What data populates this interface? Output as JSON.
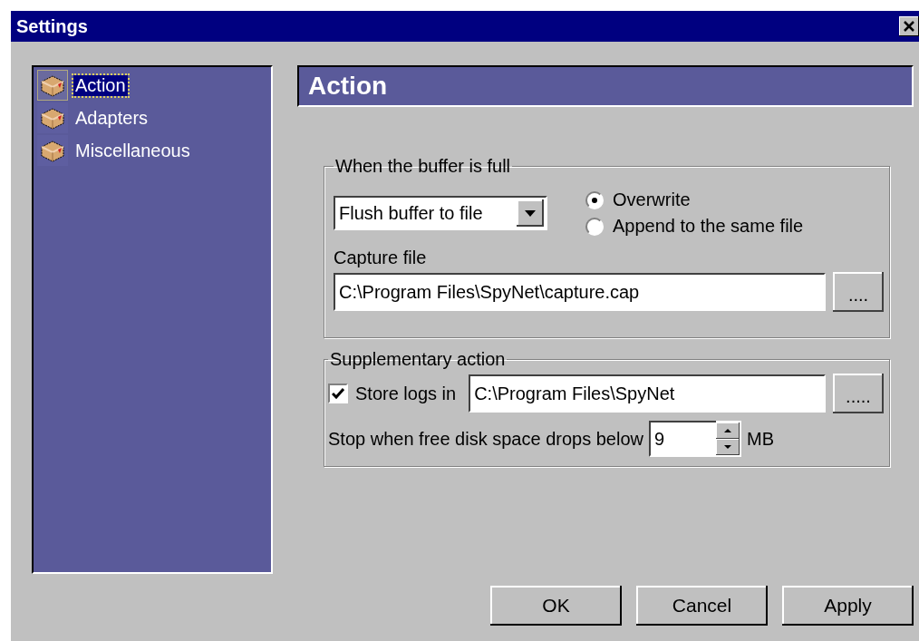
{
  "window": {
    "title": "Settings"
  },
  "sidebar": {
    "items": [
      {
        "label": "Action",
        "selected": true
      },
      {
        "label": "Adapters",
        "selected": false
      },
      {
        "label": "Miscellaneous",
        "selected": false
      }
    ]
  },
  "header": "Action",
  "buffer_group": {
    "title": "When the buffer is full",
    "action": "Flush buffer to file",
    "options": [
      {
        "label": "Overwrite",
        "selected": true
      },
      {
        "label": "Append to the same file",
        "selected": false
      }
    ],
    "file_label": "Capture file",
    "file_value": "C:\\Program Files\\SpyNet\\capture.cap",
    "browse": "...."
  },
  "supplementary_group": {
    "title": "Supplementary action",
    "store_logs": {
      "label": "Store logs in",
      "checked": true
    },
    "log_path": "C:\\Program Files\\SpyNet",
    "browse": ".....",
    "stop_label": "Stop when free disk space drops below",
    "stop_value": "9",
    "unit": "MB"
  },
  "buttons": [
    "OK",
    "Cancel",
    "Apply"
  ]
}
